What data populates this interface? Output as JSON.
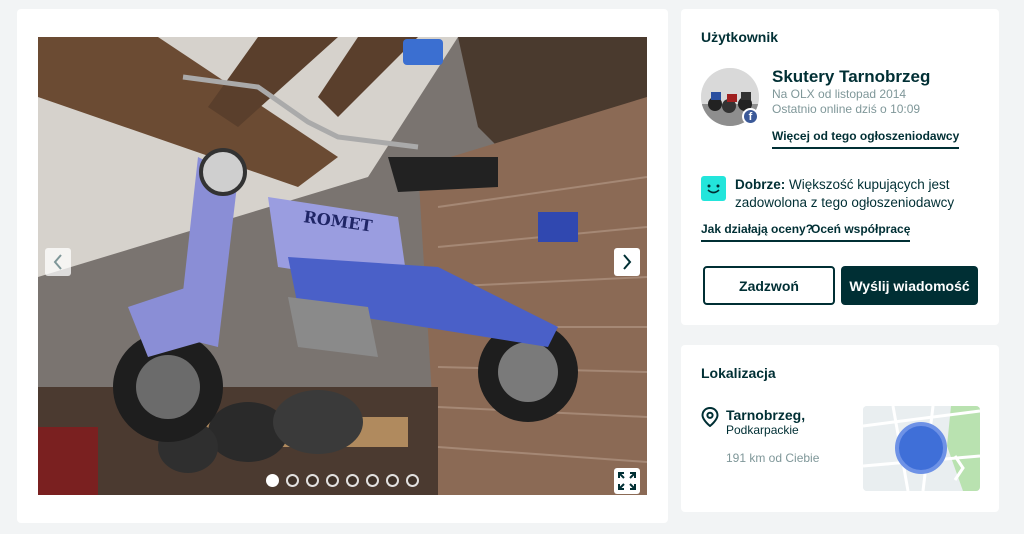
{
  "gallery": {
    "photo_alt": "Romet",
    "dots_count": 8,
    "active_dot": 0,
    "icons": {
      "prev": "chevron-left-icon",
      "next": "chevron-right-icon",
      "fullscreen": "expand-icon"
    }
  },
  "user": {
    "section_title": "Użytkownik",
    "name": "Skutery Tarnobrzeg",
    "since": "Na OLX od listopad 2014",
    "online": "Ostatnio online dziś o 10:09",
    "more_link": "Więcej od tego ogłoszeniodawcy",
    "badge": "f",
    "rating_strong": "Dobrze:",
    "rating_text": " Większość kupujących jest zadowolona z tego ogłoszeniodawcy",
    "how_ratings_link": "Jak działają oceny?",
    "rate_link": "Oceń współpracę",
    "call_button": "Zadzwoń",
    "message_button": "Wyślij wiadomość",
    "colors": {
      "accent": "#002f34",
      "smile": "#23e5db",
      "facebook": "#3b5998"
    }
  },
  "location": {
    "section_title": "Lokalizacja",
    "city": "Tarnobrzeg,",
    "region": "Podkarpackie",
    "distance": "191 km od Ciebie"
  }
}
